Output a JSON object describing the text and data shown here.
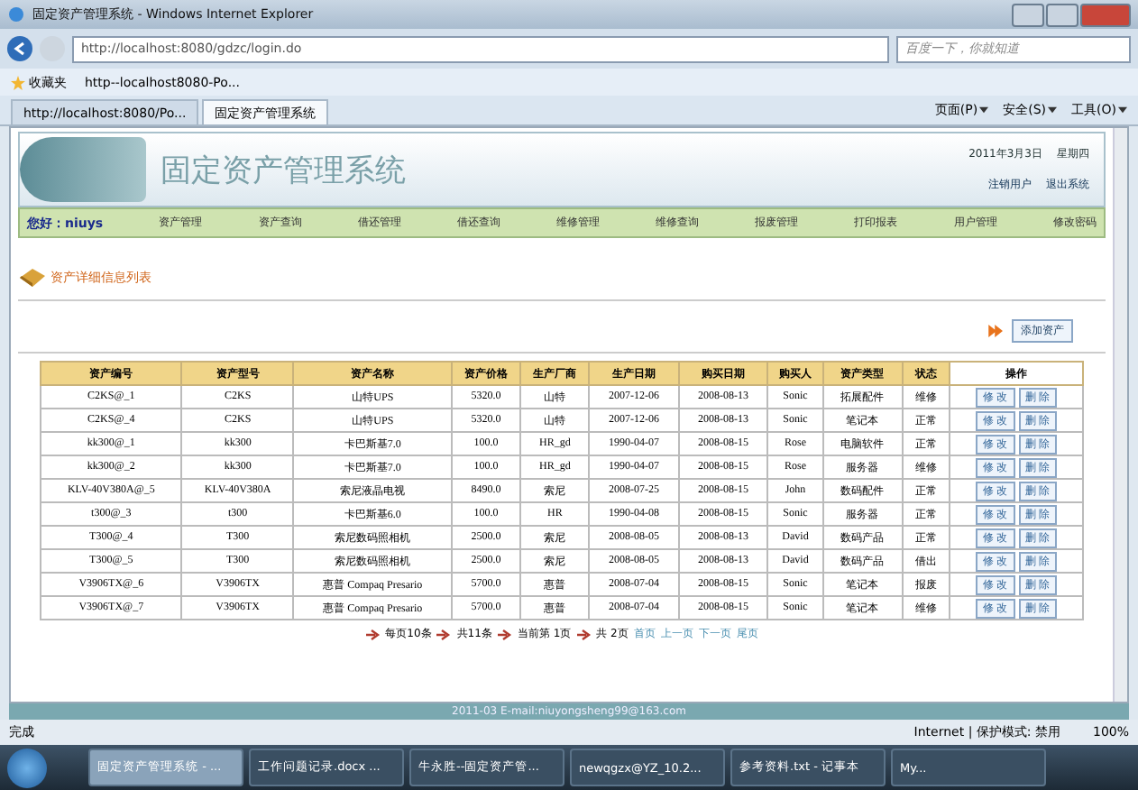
{
  "window": {
    "title": "固定资产管理系统 - Windows Internet Explorer"
  },
  "address": {
    "url": "http://localhost:8080/gdzc/login.do",
    "search_placeholder": "百度一下，你就知道"
  },
  "favorites": {
    "label": "收藏夹",
    "link": "http--localhost8080-Po..."
  },
  "tabs": [
    {
      "label": "http://localhost:8080/Po...",
      "selected": false
    },
    {
      "label": "固定资产管理系统",
      "selected": true
    }
  ],
  "toolbar": [
    "页面(P)",
    "安全(S)",
    "工具(O)"
  ],
  "header": {
    "title": "固定资产管理系统",
    "date": "2011年3月3日",
    "weekday": "星期四",
    "links": [
      "注销用户",
      "退出系统"
    ]
  },
  "nav": {
    "greeting": "您好：niuys",
    "items": [
      "资产管理",
      "资产查询",
      "借还管理",
      "借还查询",
      "维修管理",
      "维修查询",
      "报废管理",
      "打印报表",
      "用户管理",
      "修改密码"
    ]
  },
  "section_title": "资产详细信息列表",
  "add_button": "添加资产",
  "table": {
    "columns": [
      "资产编号",
      "资产型号",
      "资产名称",
      "资产价格",
      "生产厂商",
      "生产日期",
      "购买日期",
      "购买人",
      "资产类型",
      "状态",
      "操作"
    ],
    "rows": [
      {
        "cells": [
          "C2KS@_1",
          "C2KS",
          "山特UPS",
          "5320.0",
          "山特",
          "2007-12-06",
          "2008-08-13",
          "Sonic",
          "拓展配件",
          "维修"
        ],
        "actions": [
          "修 改",
          "删 除"
        ]
      },
      {
        "cells": [
          "C2KS@_4",
          "C2KS",
          "山特UPS",
          "5320.0",
          "山特",
          "2007-12-06",
          "2008-08-13",
          "Sonic",
          "笔记本",
          "正常"
        ],
        "actions": [
          "修 改",
          "删 除"
        ]
      },
      {
        "cells": [
          "kk300@_1",
          "kk300",
          "卡巴斯基7.0",
          "100.0",
          "HR_gd",
          "1990-04-07",
          "2008-08-15",
          "Rose",
          "电脑软件",
          "正常"
        ],
        "actions": [
          "修 改",
          "删 除"
        ]
      },
      {
        "cells": [
          "kk300@_2",
          "kk300",
          "卡巴斯基7.0",
          "100.0",
          "HR_gd",
          "1990-04-07",
          "2008-08-15",
          "Rose",
          "服务器",
          "维修"
        ],
        "actions": [
          "修 改",
          "删 除"
        ]
      },
      {
        "cells": [
          "KLV-40V380A@_5",
          "KLV-40V380A",
          "索尼液晶电视",
          "8490.0",
          "索尼",
          "2008-07-25",
          "2008-08-15",
          "John",
          "数码配件",
          "正常"
        ],
        "actions": [
          "修 改",
          "删 除"
        ]
      },
      {
        "cells": [
          "t300@_3",
          "t300",
          "卡巴斯基6.0",
          "100.0",
          "HR",
          "1990-04-08",
          "2008-08-15",
          "Sonic",
          "服务器",
          "正常"
        ],
        "actions": [
          "修 改",
          "删 除"
        ]
      },
      {
        "cells": [
          "T300@_4",
          "T300",
          "索尼数码照相机",
          "2500.0",
          "索尼",
          "2008-08-05",
          "2008-08-13",
          "David",
          "数码产品",
          "正常"
        ],
        "actions": [
          "修 改",
          "删 除"
        ]
      },
      {
        "cells": [
          "T300@_5",
          "T300",
          "索尼数码照相机",
          "2500.0",
          "索尼",
          "2008-08-05",
          "2008-08-13",
          "David",
          "数码产品",
          "借出"
        ],
        "actions": [
          "修 改",
          "删 除"
        ]
      },
      {
        "cells": [
          "V3906TX@_6",
          "V3906TX",
          "惠普 Compaq Presario",
          "5700.0",
          "惠普",
          "2008-07-04",
          "2008-08-15",
          "Sonic",
          "笔记本",
          "报废"
        ],
        "actions": [
          "修 改",
          "删 除"
        ]
      },
      {
        "cells": [
          "V3906TX@_7",
          "V3906TX",
          "惠普 Compaq Presario",
          "5700.0",
          "惠普",
          "2008-07-04",
          "2008-08-15",
          "Sonic",
          "笔记本",
          "维修"
        ],
        "actions": [
          "修 改",
          "删 除"
        ]
      }
    ]
  },
  "pagination": {
    "info": [
      "每页10条",
      "共11条",
      "当前第 1页",
      "共 2页"
    ],
    "links": [
      "首页",
      "上一页",
      "下一页",
      "尾页"
    ]
  },
  "footer": "2011-03 E-mail:niuyongsheng99@163.com",
  "status_bar": {
    "text": "完成",
    "zone": "Internet | 保护模式: 禁用",
    "zoom": "100%"
  },
  "taskbar": [
    {
      "label": "固定资产管理系统 - ...",
      "selected": true
    },
    {
      "label": "工作问题记录.docx ...",
      "selected": false
    },
    {
      "label": "牛永胜--固定资产管...",
      "selected": false
    },
    {
      "label": "newqgzx@YZ_10.2...",
      "selected": false
    },
    {
      "label": "参考资料.txt - 记事本",
      "selected": false
    },
    {
      "label": "My...",
      "selected": false
    }
  ]
}
